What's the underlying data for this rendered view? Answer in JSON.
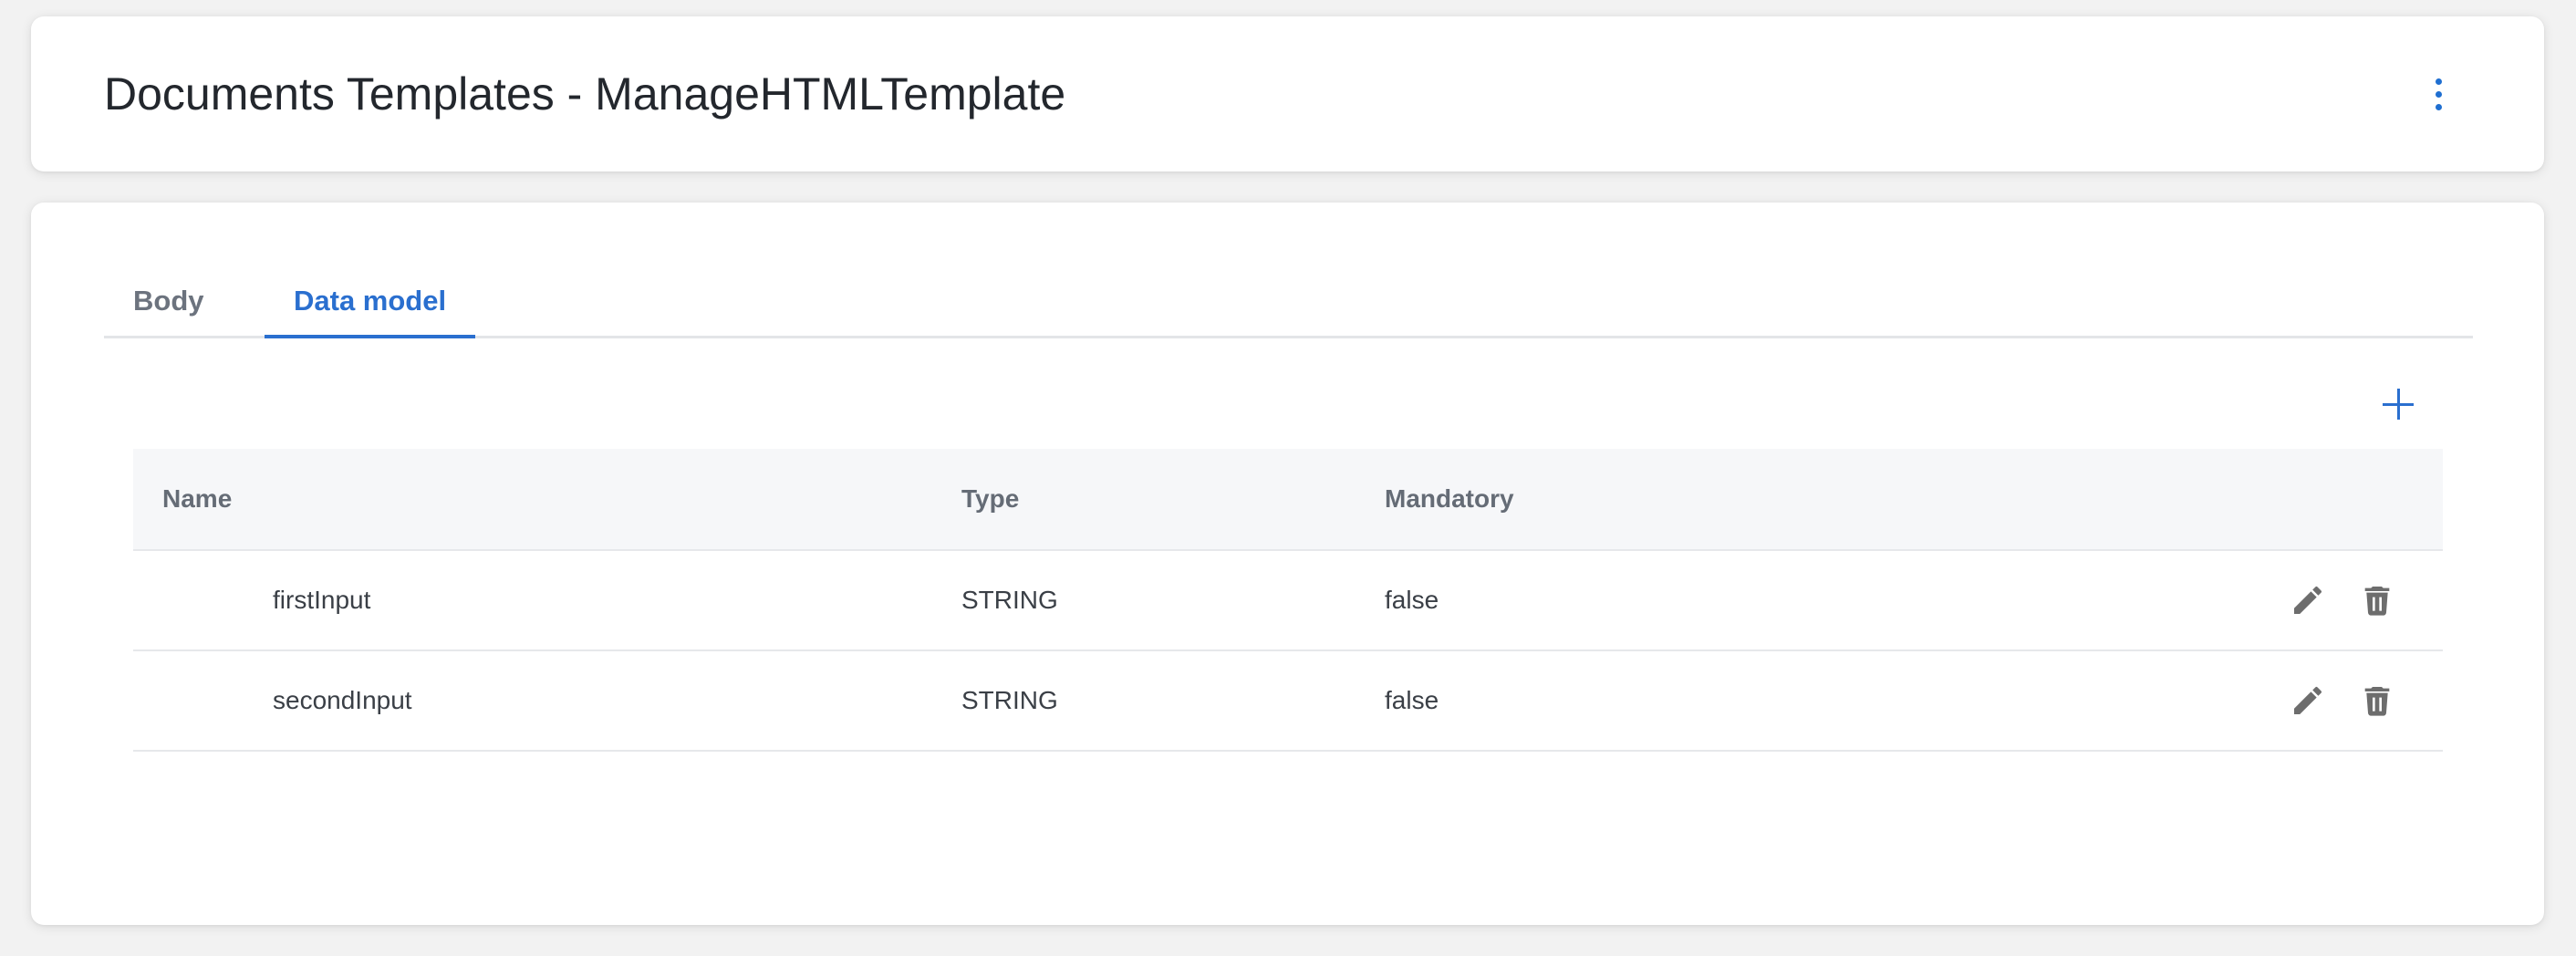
{
  "header": {
    "title": "Documents Templates - ManageHTMLTemplate",
    "menu_icon": "more-vertical-icon"
  },
  "tabs": [
    {
      "label": "Body",
      "active": false
    },
    {
      "label": "Data model",
      "active": true
    }
  ],
  "toolbar": {
    "add_icon": "plus-icon"
  },
  "table": {
    "columns": [
      "Name",
      "Type",
      "Mandatory"
    ],
    "rows": [
      {
        "name": "firstInput",
        "type": "STRING",
        "mandatory": "false"
      },
      {
        "name": "secondInput",
        "type": "STRING",
        "mandatory": "false"
      }
    ],
    "row_actions": [
      "edit-icon",
      "delete-icon"
    ]
  },
  "colors": {
    "accent": "#2a6fcf",
    "background": "#f2f2f2",
    "card": "#ffffff",
    "table_header_bg": "#f6f7f9",
    "muted_text": "#6c737e",
    "icon_gray": "#6d6d6d"
  }
}
